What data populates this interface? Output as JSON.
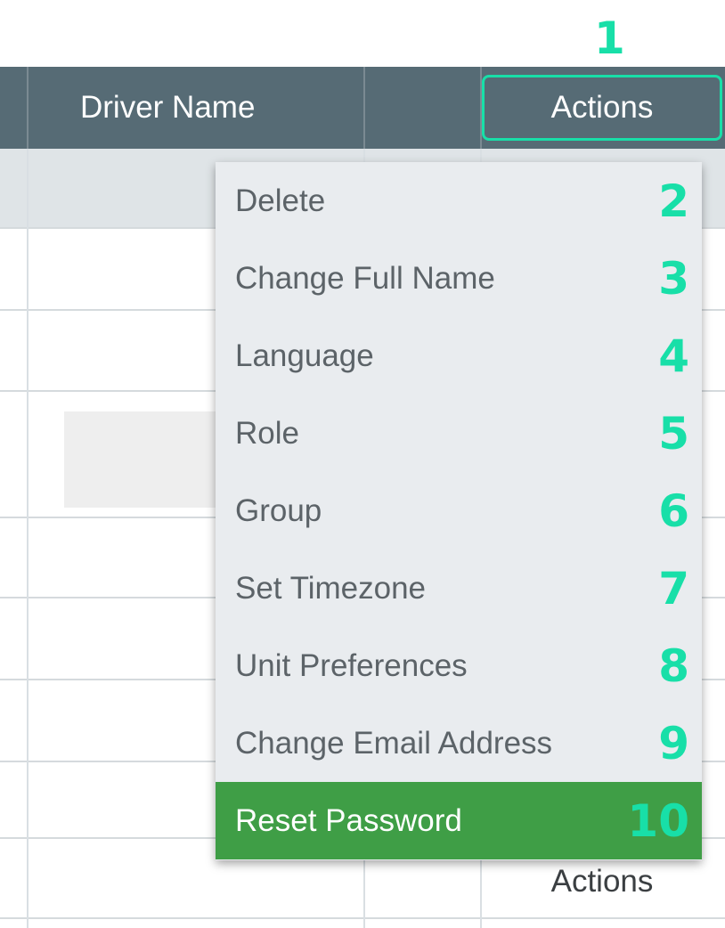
{
  "annotation": {
    "header_marker": "1"
  },
  "table": {
    "columns": [
      {
        "label": ""
      },
      {
        "label": "Driver Name"
      },
      {
        "label": ""
      },
      {
        "label": "Actions"
      }
    ],
    "bottom_row_actions_label": "Actions"
  },
  "menu": {
    "items": [
      {
        "label": "Delete",
        "marker": "2"
      },
      {
        "label": "Change Full Name",
        "marker": "3"
      },
      {
        "label": "Language",
        "marker": "4"
      },
      {
        "label": "Role",
        "marker": "5"
      },
      {
        "label": "Group",
        "marker": "6"
      },
      {
        "label": "Set Timezone",
        "marker": "7"
      },
      {
        "label": "Unit Preferences",
        "marker": "8"
      },
      {
        "label": "Change Email Address",
        "marker": "9"
      },
      {
        "label": "Reset Password",
        "marker": "10",
        "active": true
      }
    ]
  },
  "colors": {
    "header_bg": "#566b75",
    "active_item_bg": "#3f9e46",
    "annotation": "#18dfa8",
    "menu_bg": "#e9ecef"
  }
}
